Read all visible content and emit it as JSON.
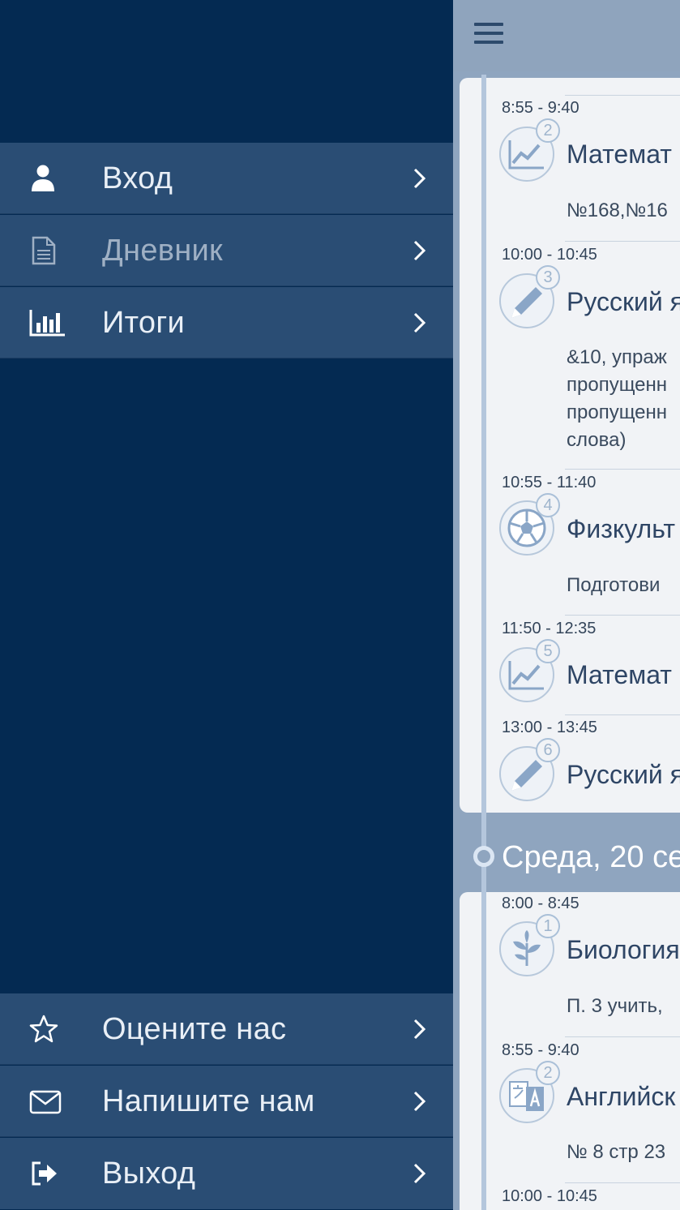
{
  "drawer": {
    "top_items": [
      {
        "label": "Вход",
        "icon": "user-icon"
      },
      {
        "label": "Дневник",
        "icon": "document-icon"
      },
      {
        "label": "Итоги",
        "icon": "bar-chart-icon"
      }
    ],
    "bottom_items": [
      {
        "label": "Оцените нас",
        "icon": "star-icon"
      },
      {
        "label": "Напишите нам",
        "icon": "envelope-icon"
      },
      {
        "label": "Выход",
        "icon": "logout-icon"
      }
    ]
  },
  "content": {
    "day1_lessons": [
      {
        "time": "8:55 - 9:40",
        "num": "2",
        "subject": "Математ",
        "homework": [
          "№168,№16"
        ],
        "icon": "chart-line-icon"
      },
      {
        "time": "10:00 - 10:45",
        "num": "3",
        "subject": "Русский я",
        "homework": [
          "&10, упраж",
          "пропущенн",
          "пропущенн",
          "слова)"
        ],
        "icon": "pen-icon"
      },
      {
        "time": "10:55 - 11:40",
        "num": "4",
        "subject": "Физкульт",
        "homework": [
          "Подготови"
        ],
        "icon": "soccer-ball-icon"
      },
      {
        "time": "11:50 - 12:35",
        "num": "5",
        "subject": "Математ",
        "homework": [],
        "icon": "chart-line-icon"
      },
      {
        "time": "13:00 - 13:45",
        "num": "6",
        "subject": "Русский я",
        "homework": [],
        "icon": "pen-icon"
      }
    ],
    "day2_header": "Среда, 20 се",
    "day2_lessons": [
      {
        "time": "8:00 - 8:45",
        "num": "1",
        "subject": "Биология",
        "homework": [
          "П. 3 учить,"
        ],
        "icon": "leaf-icon"
      },
      {
        "time": "8:55 - 9:40",
        "num": "2",
        "subject": "Английск",
        "homework": [
          "№ 8 стр 23"
        ],
        "icon": "translate-icon"
      },
      {
        "time": "10:00 - 10:45",
        "num": "",
        "subject": "",
        "homework": [],
        "icon": ""
      }
    ]
  }
}
